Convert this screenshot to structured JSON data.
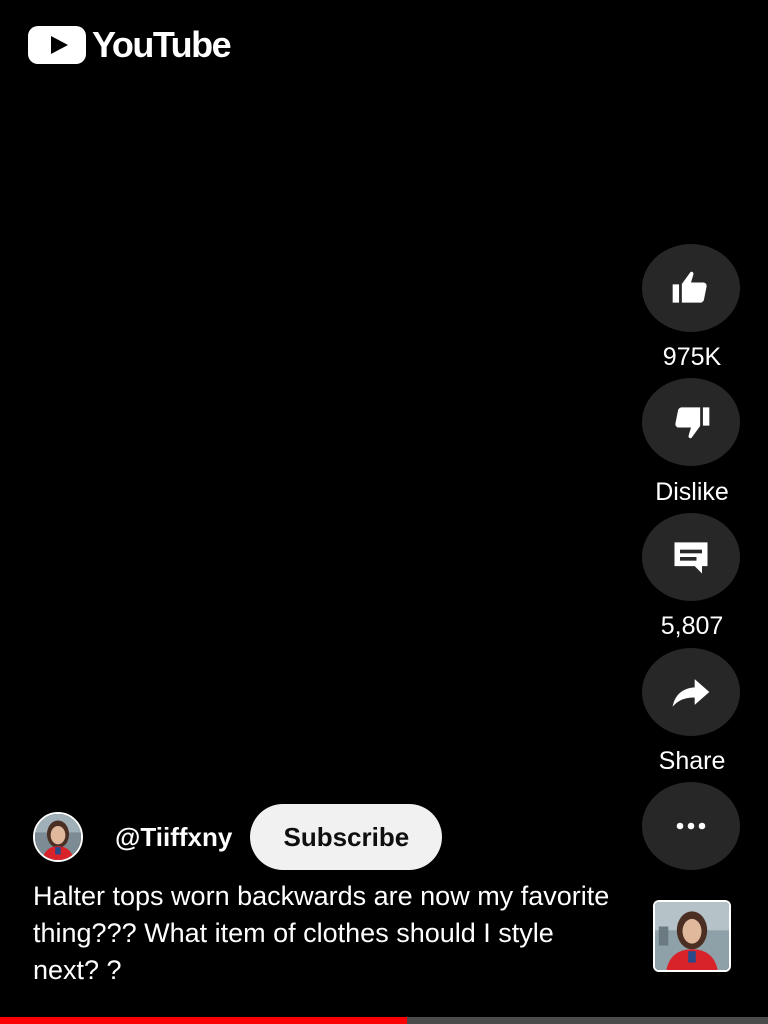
{
  "header": {
    "brand": "YouTube",
    "logo_color": "#ffffff"
  },
  "actions": {
    "like_label": "975K",
    "dislike_label": "Dislike",
    "comments_label": "5,807",
    "share_label": "Share"
  },
  "channel": {
    "handle": "@Tiiffxny",
    "subscribe_label": "Subscribe"
  },
  "caption": "Halter tops worn backwards are now my favorite thing??? What item of clothes should I style next? ?",
  "progress": {
    "fraction": 0.53,
    "played_color": "#ff0000",
    "track_color": "#4b4b4b"
  },
  "colors": {
    "background": "#000000",
    "button_bg": "#272727",
    "subscribe_bg": "#f1f1f1"
  }
}
